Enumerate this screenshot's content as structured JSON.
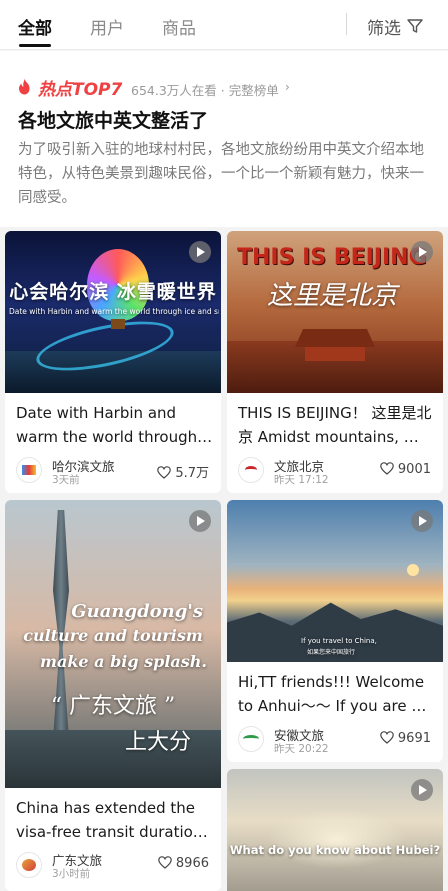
{
  "tabs": [
    {
      "label": "全部",
      "active": true
    },
    {
      "label": "用户"
    },
    {
      "label": "商品"
    }
  ],
  "filter": {
    "label": "筛选",
    "icon": "funnel-icon"
  },
  "hot": {
    "icon": "flame-icon",
    "label": "热点TOP7",
    "stats": "654.3万人在看 · 完整榜单",
    "title": "各地文旅中英文整活了",
    "description": "为了吸引新入驻的地球村村民，各地文旅纷纷用中英文介绍本地特色，从特色美景到趣味民俗，一个比一个新颖有魅力，快来一同感受。"
  },
  "cards": [
    {
      "title": "Date with Harbin and warm the world through…",
      "overlay_top": "心会哈尔滨 冰雪暖世界",
      "overlay_sub": "Date with Harbin and warm the world through ice and snow",
      "author": "哈尔滨文旅",
      "time": "3天前",
      "likes": "5.7万"
    },
    {
      "title": "THIS IS BEIJING！ 这里是北京 Amidst mountains, …",
      "overlay_top": "THIS IS BEIJING",
      "overlay_sub": "这里是北京",
      "author": "文旅北京",
      "time": "昨天 17:12",
      "likes": "9001"
    },
    {
      "title": "China has extended the visa-free transit duratio…",
      "overlay_lines": [
        "Guangdong's",
        "culture and tourism",
        "make a big splash.",
        "“ 广东文旅 ”",
        "上大分"
      ],
      "author": "广东文旅",
      "time": "3小时前",
      "likes": "8966"
    },
    {
      "title": "Hi,TT friends!!! Welcome to Anhui～～ If you are …",
      "overlay_sub": "If you travel to China,",
      "overlay_sub2": "如果您来中国旅行",
      "author": "安徽文旅",
      "time": "昨天 20:22",
      "likes": "9691"
    },
    {
      "overlay_top": "What do you know about Hubei?"
    }
  ],
  "colors": {
    "accent": "#f04142",
    "bg": "#f3f3f3"
  }
}
